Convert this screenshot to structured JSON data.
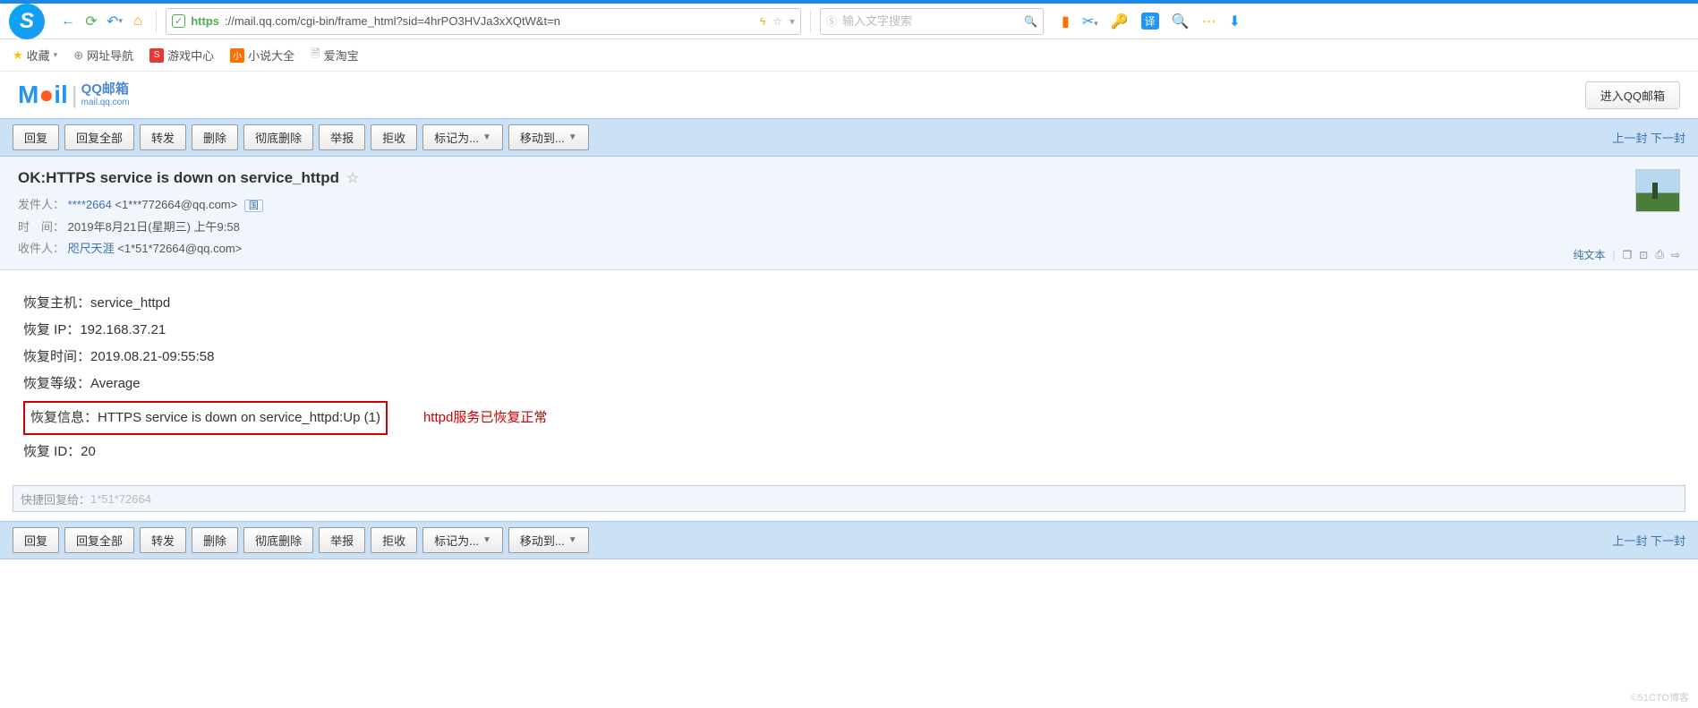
{
  "browser": {
    "url_https": "https",
    "url_rest": "://mail.qq.com/cgi-bin/frame_html?sid=4hrPO3HVJa3xXQtW&t=n",
    "search_placeholder": "输入文字搜索"
  },
  "bookmarks": {
    "fav": "收藏",
    "nav": "网址导航",
    "game": "游戏中心",
    "novel": "小说大全",
    "taobao": "爱淘宝"
  },
  "mailbox": {
    "brand_cn": "QQ邮箱",
    "brand_en": "mail.qq.com",
    "enter_btn": "进入QQ邮箱"
  },
  "toolbar": {
    "reply": "回复",
    "reply_all": "回复全部",
    "forward": "转发",
    "delete": "删除",
    "delete_perm": "彻底删除",
    "report": "举报",
    "reject": "拒收",
    "mark_as": "标记为...",
    "move_to": "移动到...",
    "prev_next": "上一封 下一封"
  },
  "message": {
    "subject": "OK:HTTPS service is down on service_httpd",
    "from_label": "发件人：",
    "from_name": "****2664",
    "from_addr": "<1***772664@qq.com>",
    "time_label": "时　间：",
    "time_value": "2019年8月21日(星期三) 上午9:58",
    "to_label": "收件人：",
    "to_name": "咫尺天涯",
    "to_addr": "<1*51*72664@qq.com>",
    "plain_text": "纯文本"
  },
  "body": {
    "line1": "恢复主机：service_httpd",
    "line2": "恢复 IP：192.168.37.21",
    "line3": "恢复时间：2019.08.21-09:55:58",
    "line4": "恢复等级：Average",
    "line5": "恢复信息：HTTPS service is down on service_httpd:Up (1)",
    "line6": "恢复 ID：20",
    "annotation": "httpd服务已恢复正常"
  },
  "quick_reply": {
    "prefix": "快捷回复给：",
    "target": "1*51*72664"
  },
  "watermark": "©51CTO博客"
}
